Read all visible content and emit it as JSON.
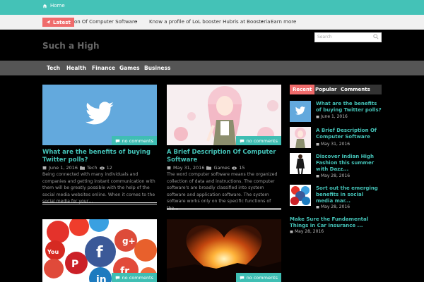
{
  "topbar": {
    "home_label": "Home"
  },
  "ticker": {
    "latest_label": "Latest",
    "items": [
      "otion Of Computer Software",
      "Know a profile of LoL booster Hubris at Boosteria",
      "Earn more go"
    ]
  },
  "search": {
    "placeholder": "Search"
  },
  "site": {
    "title": "Such a High"
  },
  "nav": {
    "items": [
      "Tech",
      "Health",
      "Finance",
      "Games",
      "Business"
    ]
  },
  "posts": [
    {
      "badge": "no comments",
      "title": "What are the benefits of buying Twitter polls?",
      "date": "June 1, 2016",
      "category": "Tech",
      "views": "12",
      "excerpt": "Being connected with many individuals and companies and getting instant communication with them will be greatly possible with the help of the social media websites online. When it comes to the social media for your…"
    },
    {
      "badge": "no comments",
      "title": "A Brief Description Of Computer Software",
      "date": "May 31, 2016",
      "category": "Games",
      "views": "15",
      "excerpt": "The word computer software means the organized collection of data and instructions. The computer software's are broadly classified into system software and application software. The system software works only on the specific functions of the…"
    },
    {
      "badge": "no comments"
    },
    {
      "badge": "no comments"
    }
  ],
  "sidebar": {
    "tabs": [
      "Recent",
      "Popular",
      "Comments"
    ],
    "items": [
      {
        "title": "What are the benefits of buying Twitter polls?",
        "date": "June 1, 2016"
      },
      {
        "title": "A Brief Description Of Computer Software",
        "date": "May 31, 2016"
      },
      {
        "title": "Discover Indian High Fashion this summer with Dazz...",
        "date": "May 28, 2016"
      },
      {
        "title": "Sort out the emerging benefits in social media mar...",
        "date": "May 28, 2016"
      },
      {
        "title": "Make Sure the Fundamental Things in Car Insurance ...",
        "date": "May 28, 2016"
      }
    ]
  },
  "colors": {
    "accent": "#44c2b7",
    "latest": "#ef6b6b",
    "nav": "#555555"
  }
}
